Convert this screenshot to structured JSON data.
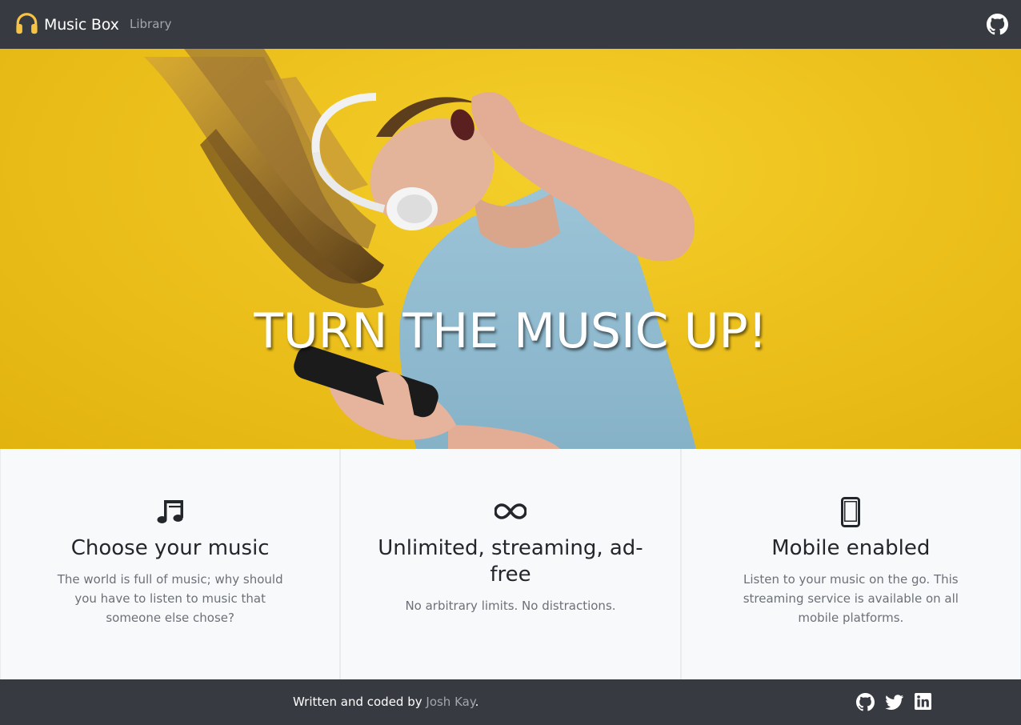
{
  "navbar": {
    "brand": "Music Box",
    "link": "Library",
    "brand_icon": "headphones-icon",
    "github_icon": "github-icon"
  },
  "hero": {
    "title": "TURN THE MUSIC UP!"
  },
  "features": [
    {
      "icon": "music-note-icon",
      "title": "Choose your music",
      "text": "The world is full of music; why should you have to listen to music that someone else chose?"
    },
    {
      "icon": "infinity-icon",
      "title": "Unlimited, streaming, ad-free",
      "text": "No arbitrary limits. No distractions."
    },
    {
      "icon": "mobile-phone-icon",
      "title": "Mobile enabled",
      "text": "Listen to your music on the go. This streaming service is available on all mobile platforms."
    }
  ],
  "footer": {
    "prefix": "Written and coded by ",
    "author": "Josh Kay",
    "suffix": ".",
    "social": [
      "github-icon",
      "twitter-icon",
      "linkedin-icon"
    ]
  },
  "colors": {
    "navbar_bg": "#373a41",
    "hero_yellow": "#edc11d",
    "brand_accent": "#f6c344",
    "muted_link": "#a3a6ab"
  }
}
